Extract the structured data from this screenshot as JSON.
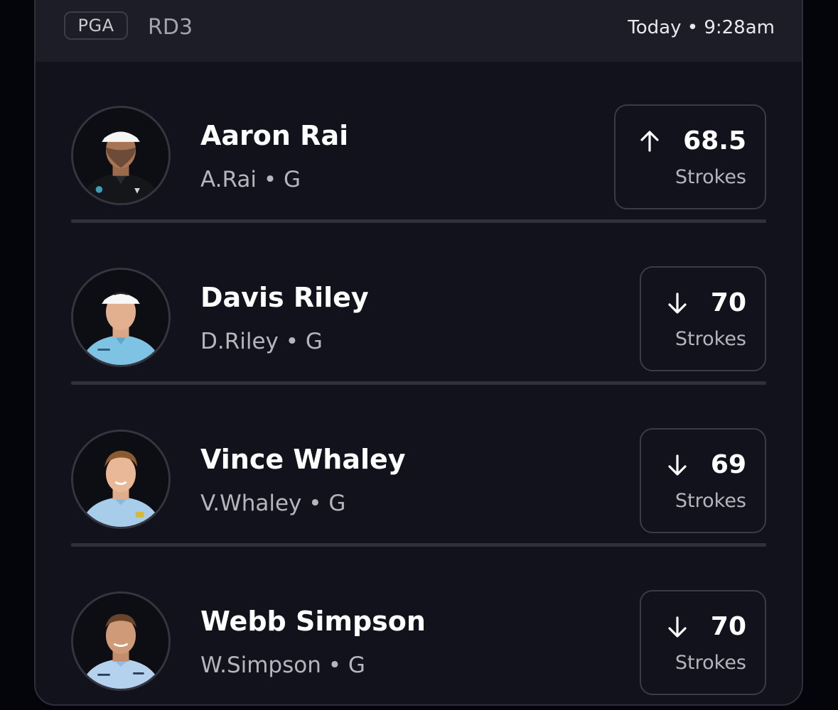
{
  "header": {
    "league": "PGA",
    "round": "RD3",
    "timestamp": "Today • 9:28am"
  },
  "colors": {
    "background": "#04050a",
    "card": "#12121c",
    "header": "#1c1d26",
    "border": "#3a3b44",
    "text_primary": "#ffffff",
    "text_secondary": "#b4b5bd"
  },
  "players": [
    {
      "name": "Aaron Rai",
      "short_name": "A.Rai",
      "position": "G",
      "direction": "up",
      "direction_icon": "arrow-up-icon",
      "value": "68.5",
      "unit": "Strokes"
    },
    {
      "name": "Davis Riley",
      "short_name": "D.Riley",
      "position": "G",
      "direction": "down",
      "direction_icon": "arrow-down-icon",
      "value": "70",
      "unit": "Strokes"
    },
    {
      "name": "Vince Whaley",
      "short_name": "V.Whaley",
      "position": "G",
      "direction": "down",
      "direction_icon": "arrow-down-icon",
      "value": "69",
      "unit": "Strokes"
    },
    {
      "name": "Webb Simpson",
      "short_name": "W.Simpson",
      "position": "G",
      "direction": "down",
      "direction_icon": "arrow-down-icon",
      "value": "70",
      "unit": "Strokes"
    }
  ]
}
